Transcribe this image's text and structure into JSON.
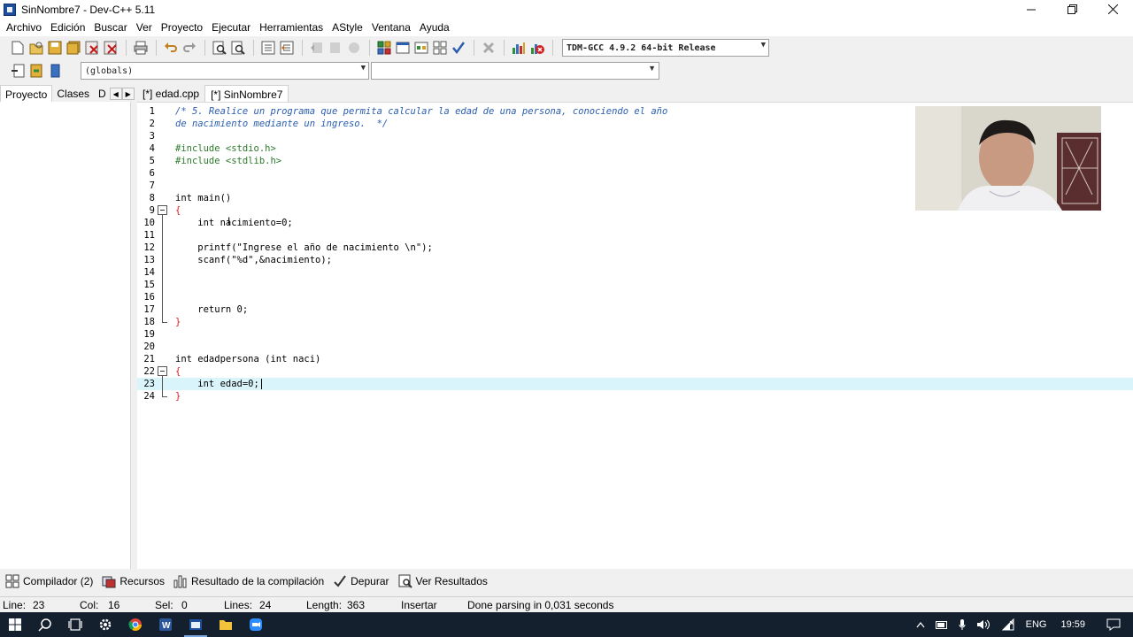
{
  "window": {
    "title": "SinNombre7 - Dev-C++ 5.11",
    "controls": [
      "minimize-icon",
      "restore-icon",
      "close-icon"
    ]
  },
  "menu": [
    "Archivo",
    "Edición",
    "Buscar",
    "Ver",
    "Proyecto",
    "Ejecutar",
    "Herramientas",
    "AStyle",
    "Ventana",
    "Ayuda"
  ],
  "toolbar": {
    "compiler": "TDM-GCC 4.9.2 64-bit Release",
    "scope": "(globals)",
    "function": ""
  },
  "left_panel": {
    "tabs": [
      "Proyecto",
      "Clases",
      "D"
    ]
  },
  "editor_tabs": [
    "[*] edad.cpp",
    "[*] SinNombre7"
  ],
  "code_lines": [
    {
      "n": "1",
      "t": "/* 5. Realice un programa que permita calcular la edad de una persona, conociendo el año"
    },
    {
      "n": "2",
      "t": "de nacimiento mediante un ingreso.  */"
    },
    {
      "n": "3",
      "t": ""
    },
    {
      "n": "4",
      "t": "#include <stdio.h>"
    },
    {
      "n": "5",
      "t": "#include <stdlib.h>"
    },
    {
      "n": "6",
      "t": ""
    },
    {
      "n": "7",
      "t": ""
    },
    {
      "n": "8",
      "t": "int main()"
    },
    {
      "n": "9",
      "t": "{"
    },
    {
      "n": "10",
      "t": "    int nacimiento=0;"
    },
    {
      "n": "11",
      "t": ""
    },
    {
      "n": "12",
      "t": "    printf(\"Ingrese el año de nacimiento \\n\");"
    },
    {
      "n": "13",
      "t": "    scanf(\"%d\",&nacimiento);"
    },
    {
      "n": "14",
      "t": ""
    },
    {
      "n": "15",
      "t": ""
    },
    {
      "n": "16",
      "t": ""
    },
    {
      "n": "17",
      "t": "    return 0;"
    },
    {
      "n": "18",
      "t": "}"
    },
    {
      "n": "19",
      "t": ""
    },
    {
      "n": "20",
      "t": ""
    },
    {
      "n": "21",
      "t": "int edadpersona (int naci)"
    },
    {
      "n": "22",
      "t": "{"
    },
    {
      "n": "23",
      "t": "    int edad=0;"
    },
    {
      "n": "24",
      "t": "}"
    }
  ],
  "bottom_tabs": [
    {
      "label": "Compilador (2)",
      "icon": "compiler-grid-icon"
    },
    {
      "label": "Recursos",
      "icon": "resources-icon"
    },
    {
      "label": "Resultado de la compilación",
      "icon": "chart-bars-icon"
    },
    {
      "label": "Depurar",
      "icon": "debug-check-icon"
    },
    {
      "label": "Ver Resultados",
      "icon": "view-results-icon"
    }
  ],
  "status": {
    "line_label": "Line:",
    "line_value": "23",
    "col_label": "Col:",
    "col_value": "16",
    "sel_label": "Sel:",
    "sel_value": "0",
    "lines_label": "Lines:",
    "lines_value": "24",
    "length_label": "Length:",
    "length_value": "363",
    "mode": "Insertar",
    "message": "Done parsing in 0,031 seconds"
  },
  "taskbar": {
    "lang": "ENG",
    "time": "19:59"
  },
  "colors": {
    "current_line": "#d9f5fb",
    "comment": "#2a5db0",
    "preprocessor": "#2d7a2d",
    "string": "#1010c0",
    "number": "#cc2020",
    "taskbar": "#15202f"
  }
}
